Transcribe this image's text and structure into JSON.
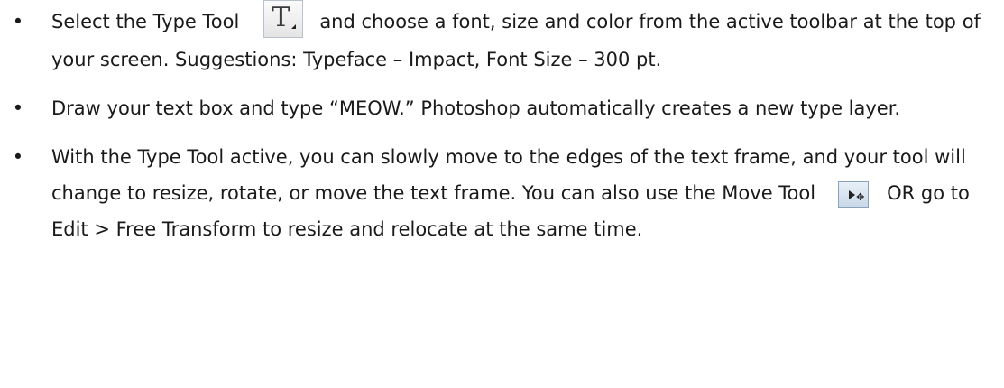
{
  "bullet_symbol": "•",
  "items": [
    {
      "before_icon": "Select the Type Tool",
      "icon": "type-tool-icon",
      "icon_glyph": "T",
      "after_icon": "and choose a font, size and color from the active toolbar at the top of your screen. Suggestions: Typeface – Impact, Font Size – 300 pt."
    },
    {
      "text": "Draw your text box and type “MEOW.” Photoshop automatically creates a new type layer."
    },
    {
      "before_icon": "With the Type Tool active, you can slowly move to the edges of the text frame, and your tool will change to resize, rotate, or move the text frame. You can also use the Move Tool",
      "icon": "move-tool-icon",
      "after_icon": "OR go to Edit > Free Transform to resize and relocate at the same time."
    }
  ]
}
